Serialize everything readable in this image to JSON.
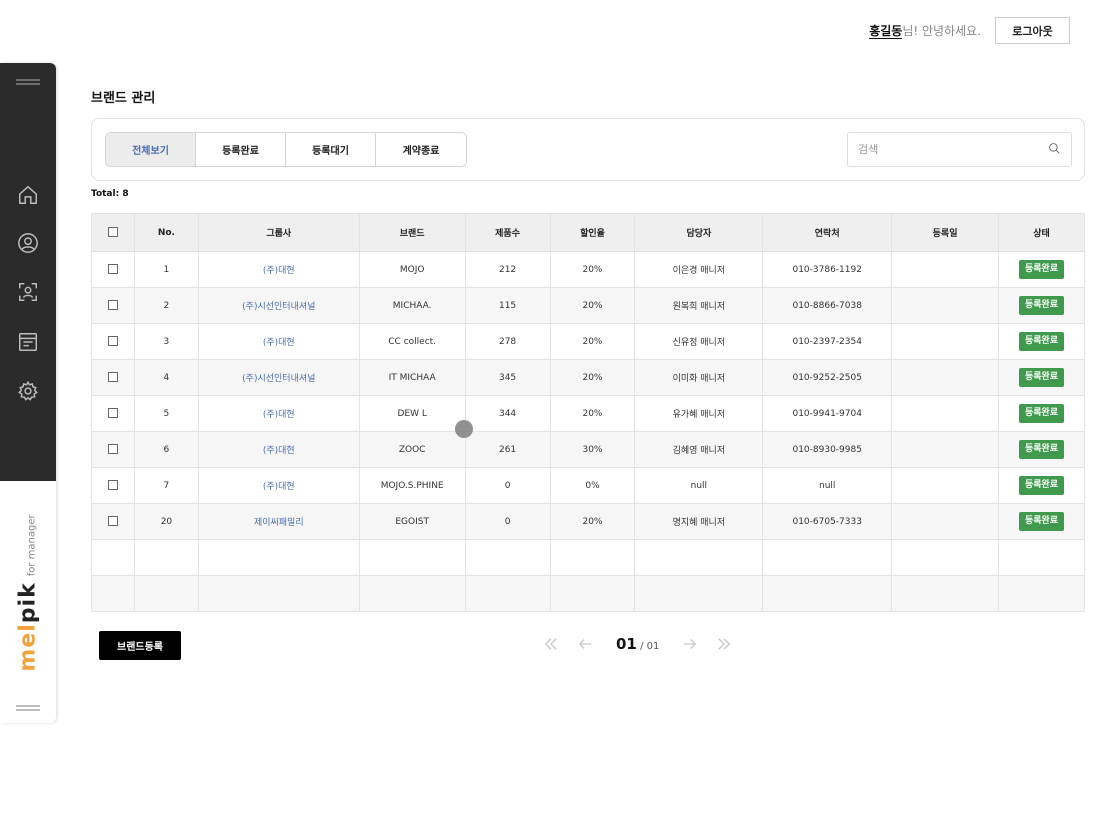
{
  "header": {
    "user_name": "홍길동",
    "greeting_suffix": "님! 안녕하세요.",
    "logout_label": "로그아웃"
  },
  "page": {
    "title": "브랜드 관리"
  },
  "filter": {
    "tabs": [
      {
        "label": "전체보기",
        "active": true
      },
      {
        "label": "등록완료",
        "active": false
      },
      {
        "label": "등록대기",
        "active": false
      },
      {
        "label": "계약종료",
        "active": false
      }
    ],
    "search_placeholder": "검색"
  },
  "total_label": "Total: 8",
  "table": {
    "columns": [
      "",
      "No.",
      "그룹사",
      "브랜드",
      "제품수",
      "할인율",
      "담당자",
      "연락처",
      "등록일",
      "상태"
    ],
    "rows": [
      {
        "no": "1",
        "group": "(주)대현",
        "brand": "MOJO",
        "products": "212",
        "discount": "20%",
        "manager": "이은경 매니저",
        "contact": "010-3786-1192",
        "date": "",
        "status": "등록완료"
      },
      {
        "no": "2",
        "group": "(주)시선인터내셔널",
        "brand": "MICHAA.",
        "products": "115",
        "discount": "20%",
        "manager": "원복희 매니저",
        "contact": "010-8866-7038",
        "date": "",
        "status": "등록완료"
      },
      {
        "no": "3",
        "group": "(주)대현",
        "brand": "CC collect.",
        "products": "278",
        "discount": "20%",
        "manager": "신유정 매니저",
        "contact": "010-2397-2354",
        "date": "",
        "status": "등록완료"
      },
      {
        "no": "4",
        "group": "(주)시선인터내셔널",
        "brand": "IT MICHAA",
        "products": "345",
        "discount": "20%",
        "manager": "이미화 매니저",
        "contact": "010-9252-2505",
        "date": "",
        "status": "등록완료"
      },
      {
        "no": "5",
        "group": "(주)대현",
        "brand": "DEW L",
        "products": "344",
        "discount": "20%",
        "manager": "유가혜 매니저",
        "contact": "010-9941-9704",
        "date": "",
        "status": "등록완료"
      },
      {
        "no": "6",
        "group": "(주)대현",
        "brand": "ZOOC",
        "products": "261",
        "discount": "30%",
        "manager": "김혜영 매니저",
        "contact": "010-8930-9985",
        "date": "",
        "status": "등록완료"
      },
      {
        "no": "7",
        "group": "(주)대현",
        "brand": "MOJO.S.PHINE",
        "products": "0",
        "discount": "0%",
        "manager": "null",
        "contact": "null",
        "date": "",
        "status": "등록완료"
      },
      {
        "no": "20",
        "group": "제이씨패밀리",
        "brand": "EGOIST",
        "products": "0",
        "discount": "20%",
        "manager": "명지혜 매니저",
        "contact": "010-6705-7333",
        "date": "",
        "status": "등록완료"
      }
    ],
    "empty_rows": 2
  },
  "footer": {
    "register_label": "브랜드등록",
    "current_page": "01",
    "total_pages": "/ 01"
  },
  "sidebar": {
    "icons": [
      "home-icon",
      "user-icon",
      "user-scan-icon",
      "window-icon",
      "gear-icon"
    ],
    "logo_main": "melpik",
    "logo_sub": "for manager"
  },
  "colors": {
    "sidebar_dark": "#2b2b2b",
    "accent_link": "#4a6fb5",
    "status_green": "#3f9a4d",
    "logo_orange": "#f2a13b"
  }
}
